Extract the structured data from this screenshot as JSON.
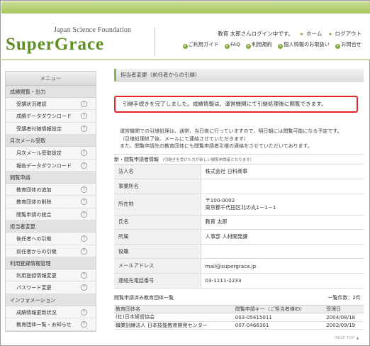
{
  "header": {
    "logo_sub": "Japan Science Foundation",
    "logo": "SuperGrace",
    "user_line": "教育 太郎さんログイン中です。",
    "home": "ホーム",
    "logout": "ログアウト",
    "nav": [
      "ご利用ガイド",
      "FAQ",
      "利用規約",
      "個人情報のお取扱い",
      "お問合せ"
    ]
  },
  "sidebar": {
    "title": "メニュー",
    "sections": [
      {
        "label": "成績閲覧・出力",
        "items": [
          "受講状況確認",
          "成績データダウンロード",
          "受講者付随情報設定"
        ]
      },
      {
        "label": "月次メール受取",
        "items": [
          "月次メール受取設定",
          "報告データダウンロード"
        ]
      },
      {
        "label": "閲覧申請",
        "items": [
          "教育団体の追加",
          "教育団体の削除",
          "閲覧申請の統合"
        ]
      },
      {
        "label": "担当者変更",
        "items": [
          "後任者への引継",
          "前任者からの引継"
        ]
      },
      {
        "label": "利用登録情報管理",
        "items": [
          "利用登録情報変更",
          "パスワード変更"
        ]
      },
      {
        "label": "インフォメーション",
        "items": [
          "成績情報更新状況",
          "教育団体一覧・お知らせ"
        ]
      }
    ]
  },
  "main": {
    "page_title": "担当者変更（前任者からの引継）",
    "alert": "引継手続きを完了しました。成績情報は、運営機関にて引継処理後に閲覧できます。",
    "info_lines": [
      "運営機関での引継処理は、通常、当日夜に行っていますので、明日朝には閲覧可能になる予定です。",
      "（引継処理終了後、メールにて連絡させていただきます）",
      "また、閲覧申請先の教育団体にも閲覧申請者引継の連絡をさせていただいております。"
    ],
    "table_title": "新・閲覧申請者情報",
    "table_note": "（引継ぎを受けた方が新しい閲覧申請者となります）",
    "rows": [
      {
        "key": "法人名",
        "value": "株式会社 日科商事"
      },
      {
        "key": "事業所名",
        "value": ""
      },
      {
        "key": "所在地",
        "value": "〒100-0002",
        "value2": "東京都千代田区北の丸1－1－1"
      },
      {
        "key": "氏名",
        "value": "教育 太郎"
      },
      {
        "key": "所属",
        "value": "人事部 人材開発課"
      },
      {
        "key": "役職",
        "value": ""
      },
      {
        "key": "メールアドレス",
        "value": "mail@supergrace.jp"
      },
      {
        "key": "連絡先電話番号",
        "value": "03-1111-2233"
      }
    ],
    "hist_title": "閲覧申請済み教育団体一覧",
    "hist_count": "一覧件数：2件",
    "hist_cols": [
      "教育団体名",
      "閲覧申請キー（ご担当者様ID）",
      "受理日"
    ],
    "hist_rows": [
      [
        "(社)日本経営協会",
        "003-05415011",
        "2004/08/18"
      ],
      [
        "職業訓練法人 日本技能教育開発センター",
        "007-0466301",
        "2002/09/19"
      ]
    ]
  },
  "footer": {
    "page_top": "PAGE TOP ▲"
  }
}
